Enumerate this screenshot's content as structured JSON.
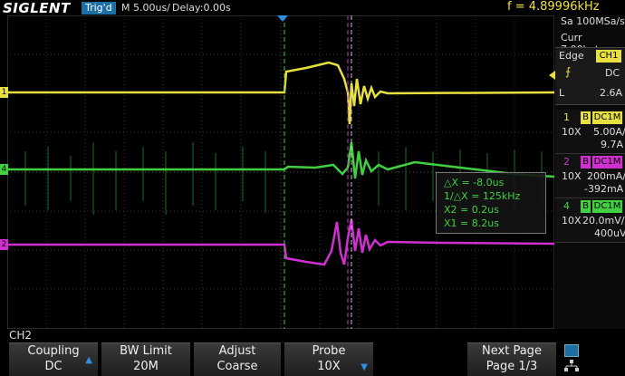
{
  "header": {
    "brand": "SIGLENT",
    "trig_status": "Trig'd",
    "timebase": "M 5.00us/",
    "delay": "Delay:0.00s",
    "frequency": "f = 4.89996kHz"
  },
  "acquisition": {
    "sample_rate": "Sa 100MSa/s",
    "memory": "Curr 7.00kpts"
  },
  "trigger": {
    "type": "Edge",
    "source": "CH1",
    "coupling": "DC",
    "level_label": "L",
    "level": "2.6A"
  },
  "channels": [
    {
      "num": "1",
      "b": "B",
      "coupling": "DC1M",
      "probe": "10X",
      "scale": "5.00A/",
      "offset": "9.7A",
      "color": "#e8e040"
    },
    {
      "num": "2",
      "b": "B",
      "coupling": "DC1M",
      "probe": "10X",
      "scale": "200mA/",
      "offset": "-392mA",
      "color": "#d030d0"
    },
    {
      "num": "4",
      "b": "B",
      "coupling": "DC1M",
      "probe": "10X",
      "scale": "20.0mV/",
      "offset": "400uV",
      "color": "#40d040"
    }
  ],
  "markers": {
    "ch1": "1",
    "ch4": "4",
    "ch2": "2"
  },
  "cursors": {
    "dx": "△X = -8.0us",
    "inv_dx": "1/△X = 125kHz",
    "x2": "X2 = 0.2us",
    "x1": "X1 = 8.2us"
  },
  "menu": {
    "title": "CH2",
    "softkeys": [
      {
        "line1": "Coupling",
        "line2": "DC"
      },
      {
        "line1": "BW Limit",
        "line2": "20M"
      },
      {
        "line1": "Adjust",
        "line2": "Coarse"
      },
      {
        "line1": "Probe",
        "line2": "10X"
      },
      {
        "line1": "Next Page",
        "line2": "Page 1/3"
      }
    ]
  },
  "colors": {
    "ch1": "#e8e040",
    "ch2": "#d030d0",
    "ch4": "#40d040",
    "cursor": "#d8d8d8",
    "accent": "#1d6fa6"
  }
}
